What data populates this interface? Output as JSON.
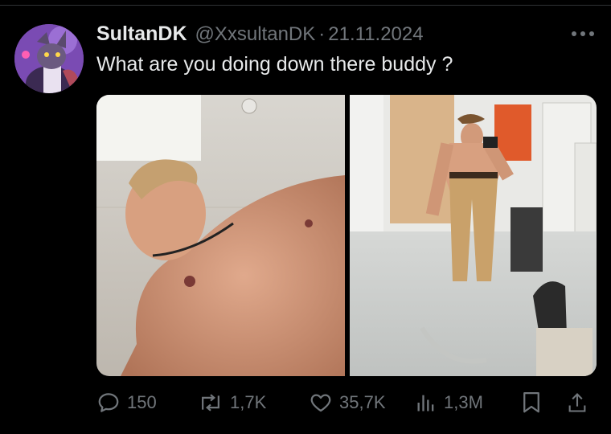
{
  "tweet": {
    "display_name": "SultanDK",
    "handle": "@XxsultanDK",
    "separator": "·",
    "date": "21.11.2024",
    "text": "What are you doing down there buddy ?"
  },
  "media": [
    {
      "kind": "photo",
      "depicts": "shirtless man photographed from below"
    },
    {
      "kind": "photo",
      "depicts": "shirtless man mirror selfie in locker room"
    }
  ],
  "actions": {
    "replies": "150",
    "reposts": "1,7K",
    "likes": "35,7K",
    "views": "1,3M"
  },
  "icons": {
    "reply": "reply-icon",
    "repost": "repost-icon",
    "like": "like-icon",
    "views": "views-icon",
    "bookmark": "bookmark-icon",
    "share": "share-icon",
    "more": "more-icon"
  },
  "colors": {
    "background": "#000000",
    "text_primary": "#e7e9ea",
    "text_secondary": "#71767b",
    "divider": "#2f3336",
    "avatar_bg": "#6a3f9e"
  }
}
